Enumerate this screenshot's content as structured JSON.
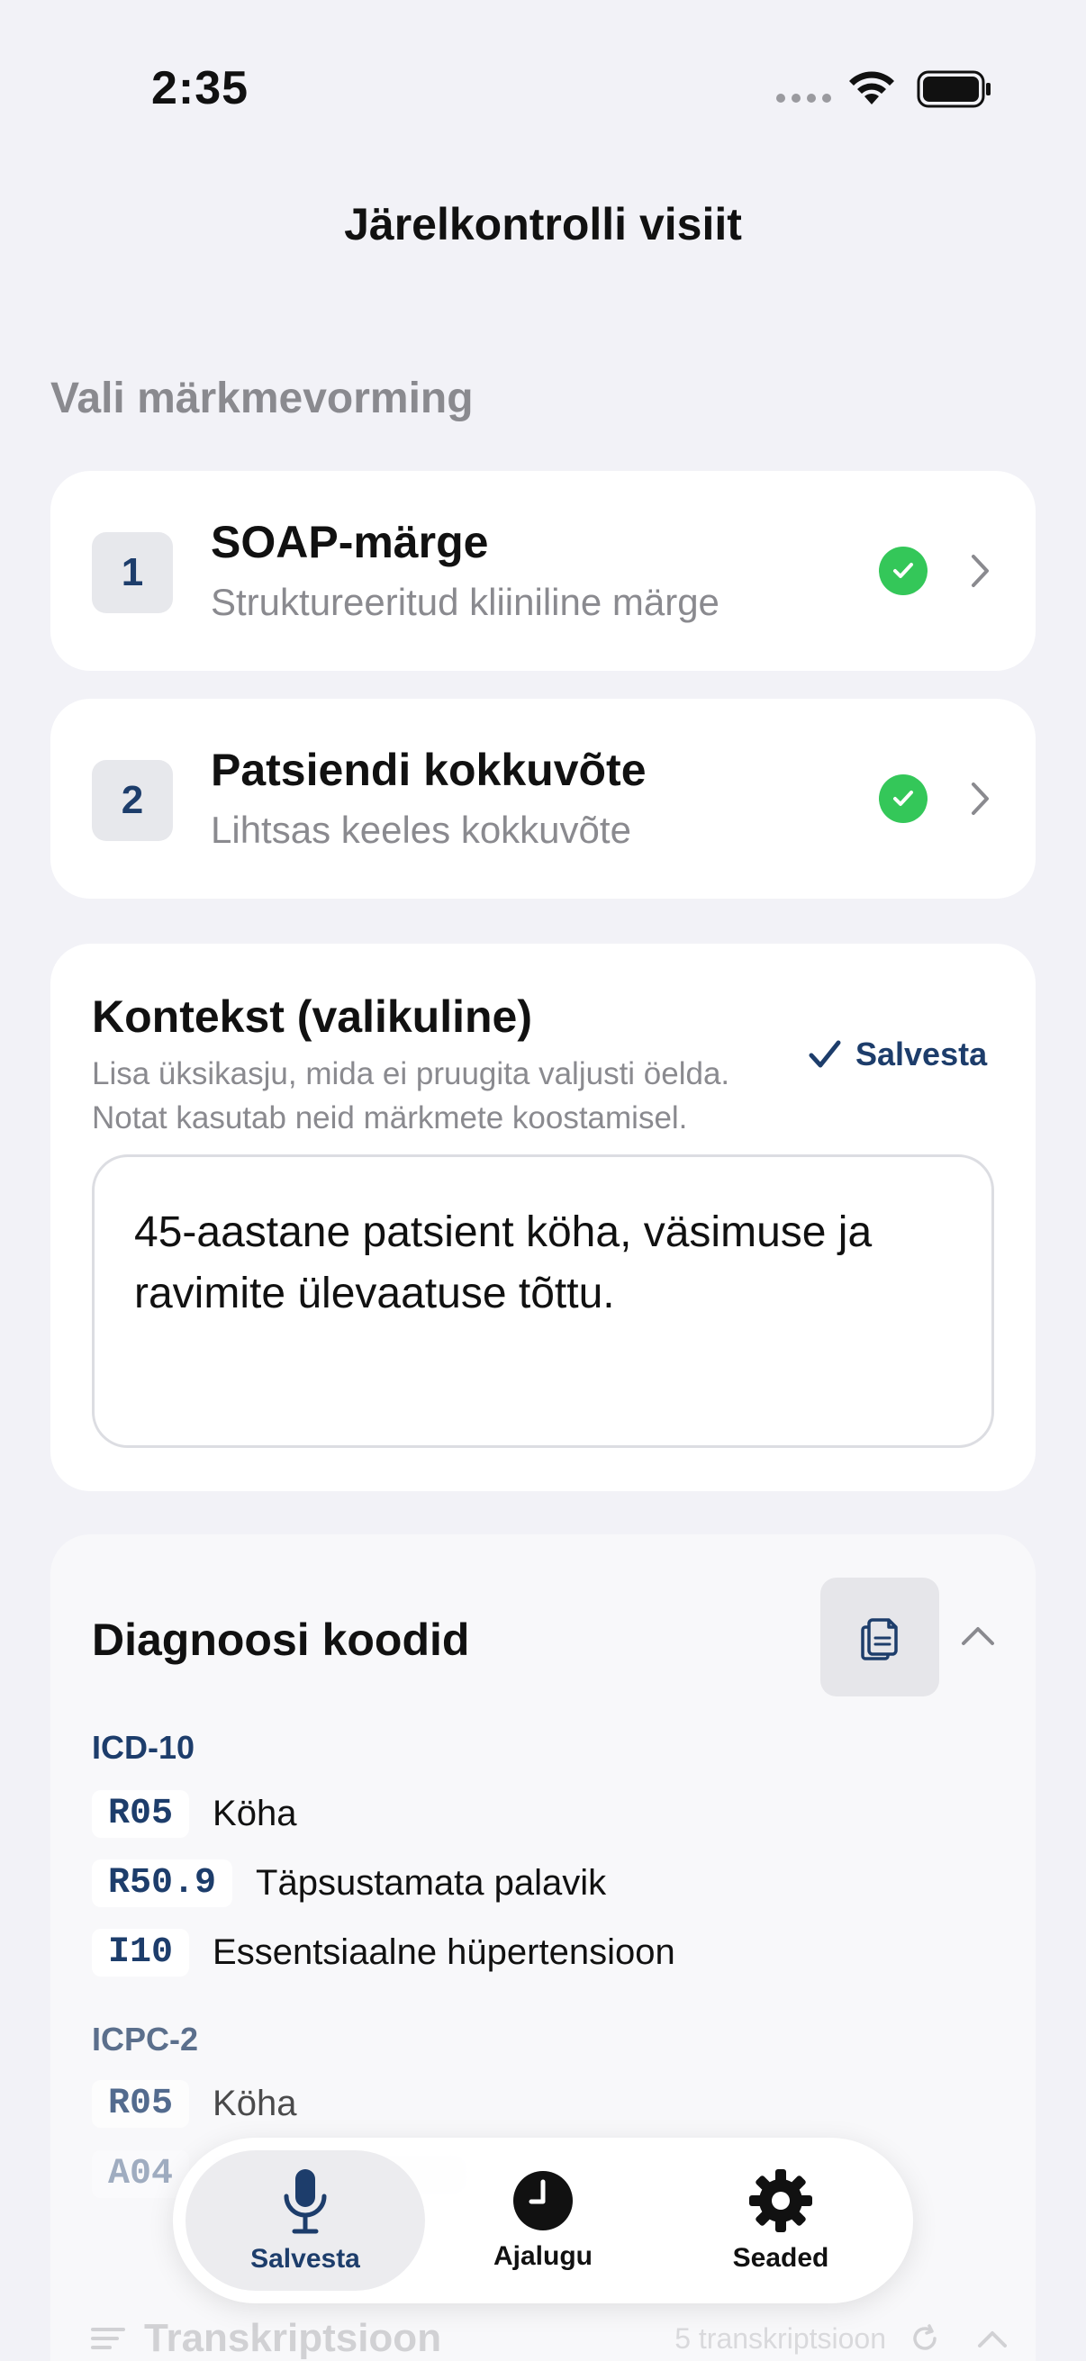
{
  "status_bar": {
    "time": "2:35"
  },
  "nav": {
    "title": "Järelkontrolli visiit"
  },
  "format_section": {
    "label": "Vali märkmevorming",
    "items": [
      {
        "number": "1",
        "title": "SOAP-märge",
        "subtitle": "Struktureeritud kliiniline märge",
        "selected": true
      },
      {
        "number": "2",
        "title": "Patsiendi kokkuvõte",
        "subtitle": "Lihtsas keeles kokkuvõte",
        "selected": true
      }
    ]
  },
  "context": {
    "title": "Kontekst (valikuline)",
    "description": "Lisa üksikasju, mida ei pruugita valjusti öelda. Notat kasutab neid märkmete koostamisel.",
    "save_label": "Salvesta",
    "text": "45-aastane patsient köha, väsimuse ja ravimite ülevaatuse tõttu."
  },
  "diagnosis": {
    "title": "Diagnoosi koodid",
    "systems": [
      {
        "name": "ICD-10",
        "codes": [
          {
            "code": "R05",
            "desc": "Köha"
          },
          {
            "code": "R50.9",
            "desc": "Täpsustamata palavik"
          },
          {
            "code": "I10",
            "desc": "Essentsiaalne hüpertensioon"
          }
        ]
      },
      {
        "name": "ICPC-2",
        "codes": [
          {
            "code": "R05",
            "desc": "Köha"
          },
          {
            "code": "A04",
            "desc": ""
          }
        ]
      }
    ]
  },
  "transcript": {
    "label": "Transkriptsioon",
    "count": "5 transkriptsioon"
  },
  "tab_bar": {
    "tabs": [
      {
        "label": "Salvesta",
        "icon": "microphone-icon",
        "active": true
      },
      {
        "label": "Ajalugu",
        "icon": "clock-icon",
        "active": false
      },
      {
        "label": "Seaded",
        "icon": "gear-icon",
        "active": false
      }
    ]
  },
  "colors": {
    "accent": "#1d3d6b",
    "success": "#34c759",
    "background": "#f2f2f7",
    "secondary_text": "#8a8a8f"
  }
}
